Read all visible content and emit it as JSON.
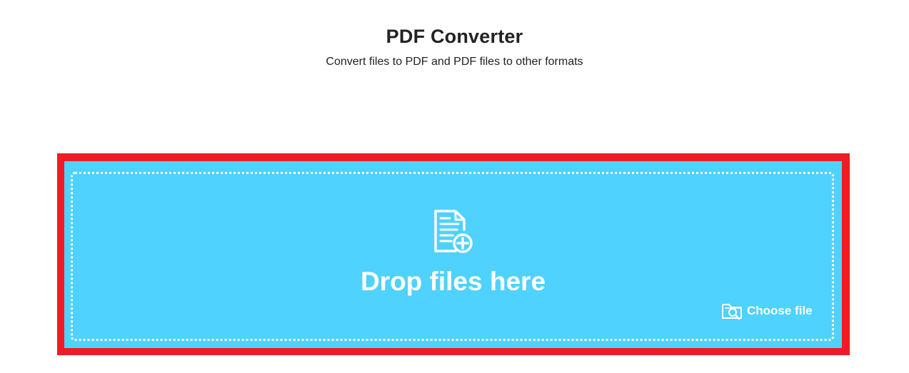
{
  "header": {
    "title": "PDF Converter",
    "subtitle": "Convert files to PDF and PDF files to other formats"
  },
  "dropzone": {
    "label": "Drop files here",
    "icon": "file-add-icon",
    "choose_file_label": "Choose file",
    "choose_file_icon": "folder-search-icon"
  },
  "colors": {
    "dropzone_background": "#4fd2fd",
    "highlight_border": "#ee1c25",
    "text_dark": "#222222",
    "text_light": "#ffffff"
  }
}
